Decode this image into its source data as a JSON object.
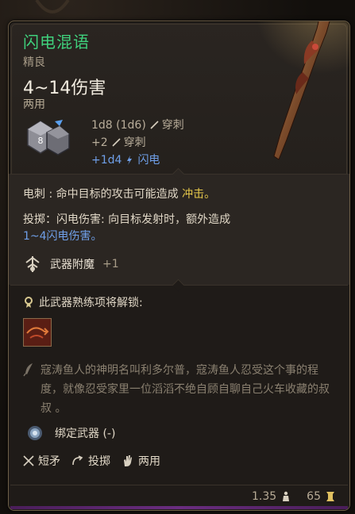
{
  "item": {
    "name": "闪电混语",
    "rarity": "精良",
    "damage": "4~14伤害",
    "handedness": "两用"
  },
  "damage_rows": [
    {
      "formula": "1d8 (1d6)",
      "type": "穿刺",
      "icon": "pierce-icon"
    },
    {
      "formula": "+2",
      "type": "穿刺",
      "icon": "pierce-icon"
    },
    {
      "formula": "+1d4",
      "type": "闪电",
      "icon": "lightning-icon"
    }
  ],
  "dice_value": "8",
  "properties": {
    "electrocute_label": "电刺 : ",
    "electrocute_text": "命中目标的攻击可能造成 ",
    "electrocute_effect": "冲击。",
    "throw_label": "投掷：",
    "throw_text": "闪电伤害: 向目标发射时，额外造成",
    "throw_damage": "1~4闪电伤害。"
  },
  "enchant": {
    "label": "武器附魔",
    "value": "+1"
  },
  "proficiency": {
    "unlock_text": "此武器熟练项将解锁:"
  },
  "lore": "寇涛鱼人的神明名叫利多尔普，寇涛鱼人忍受这个事的程度，就像忍受家里一位滔滔不绝自顾自聊自己火车收藏的叔叔 。",
  "bind": {
    "label": "绑定武器 (-)"
  },
  "tags": [
    {
      "label": "短矛",
      "icon": "spear-icon"
    },
    {
      "label": "投掷",
      "icon": "throw-icon"
    },
    {
      "label": "两用",
      "icon": "hand-icon"
    }
  ],
  "footer": {
    "weight": "1.35",
    "price": "65"
  },
  "colors": {
    "title": "#3fd07c",
    "lightning": "#6f9fe8",
    "highlight": "#e6c84a",
    "rarity_bar": "#6a2d80"
  }
}
